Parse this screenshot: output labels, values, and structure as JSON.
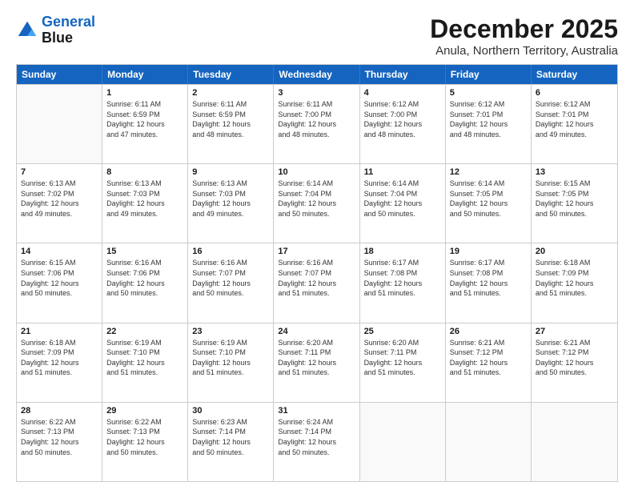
{
  "header": {
    "logo_line1": "General",
    "logo_line2": "Blue",
    "title": "December 2025",
    "subtitle": "Anula, Northern Territory, Australia"
  },
  "days_of_week": [
    "Sunday",
    "Monday",
    "Tuesday",
    "Wednesday",
    "Thursday",
    "Friday",
    "Saturday"
  ],
  "weeks": [
    [
      {
        "day": "",
        "lines": []
      },
      {
        "day": "1",
        "lines": [
          "Sunrise: 6:11 AM",
          "Sunset: 6:59 PM",
          "Daylight: 12 hours",
          "and 47 minutes."
        ]
      },
      {
        "day": "2",
        "lines": [
          "Sunrise: 6:11 AM",
          "Sunset: 6:59 PM",
          "Daylight: 12 hours",
          "and 48 minutes."
        ]
      },
      {
        "day": "3",
        "lines": [
          "Sunrise: 6:11 AM",
          "Sunset: 7:00 PM",
          "Daylight: 12 hours",
          "and 48 minutes."
        ]
      },
      {
        "day": "4",
        "lines": [
          "Sunrise: 6:12 AM",
          "Sunset: 7:00 PM",
          "Daylight: 12 hours",
          "and 48 minutes."
        ]
      },
      {
        "day": "5",
        "lines": [
          "Sunrise: 6:12 AM",
          "Sunset: 7:01 PM",
          "Daylight: 12 hours",
          "and 48 minutes."
        ]
      },
      {
        "day": "6",
        "lines": [
          "Sunrise: 6:12 AM",
          "Sunset: 7:01 PM",
          "Daylight: 12 hours",
          "and 49 minutes."
        ]
      }
    ],
    [
      {
        "day": "7",
        "lines": [
          "Sunrise: 6:13 AM",
          "Sunset: 7:02 PM",
          "Daylight: 12 hours",
          "and 49 minutes."
        ]
      },
      {
        "day": "8",
        "lines": [
          "Sunrise: 6:13 AM",
          "Sunset: 7:03 PM",
          "Daylight: 12 hours",
          "and 49 minutes."
        ]
      },
      {
        "day": "9",
        "lines": [
          "Sunrise: 6:13 AM",
          "Sunset: 7:03 PM",
          "Daylight: 12 hours",
          "and 49 minutes."
        ]
      },
      {
        "day": "10",
        "lines": [
          "Sunrise: 6:14 AM",
          "Sunset: 7:04 PM",
          "Daylight: 12 hours",
          "and 50 minutes."
        ]
      },
      {
        "day": "11",
        "lines": [
          "Sunrise: 6:14 AM",
          "Sunset: 7:04 PM",
          "Daylight: 12 hours",
          "and 50 minutes."
        ]
      },
      {
        "day": "12",
        "lines": [
          "Sunrise: 6:14 AM",
          "Sunset: 7:05 PM",
          "Daylight: 12 hours",
          "and 50 minutes."
        ]
      },
      {
        "day": "13",
        "lines": [
          "Sunrise: 6:15 AM",
          "Sunset: 7:05 PM",
          "Daylight: 12 hours",
          "and 50 minutes."
        ]
      }
    ],
    [
      {
        "day": "14",
        "lines": [
          "Sunrise: 6:15 AM",
          "Sunset: 7:06 PM",
          "Daylight: 12 hours",
          "and 50 minutes."
        ]
      },
      {
        "day": "15",
        "lines": [
          "Sunrise: 6:16 AM",
          "Sunset: 7:06 PM",
          "Daylight: 12 hours",
          "and 50 minutes."
        ]
      },
      {
        "day": "16",
        "lines": [
          "Sunrise: 6:16 AM",
          "Sunset: 7:07 PM",
          "Daylight: 12 hours",
          "and 50 minutes."
        ]
      },
      {
        "day": "17",
        "lines": [
          "Sunrise: 6:16 AM",
          "Sunset: 7:07 PM",
          "Daylight: 12 hours",
          "and 51 minutes."
        ]
      },
      {
        "day": "18",
        "lines": [
          "Sunrise: 6:17 AM",
          "Sunset: 7:08 PM",
          "Daylight: 12 hours",
          "and 51 minutes."
        ]
      },
      {
        "day": "19",
        "lines": [
          "Sunrise: 6:17 AM",
          "Sunset: 7:08 PM",
          "Daylight: 12 hours",
          "and 51 minutes."
        ]
      },
      {
        "day": "20",
        "lines": [
          "Sunrise: 6:18 AM",
          "Sunset: 7:09 PM",
          "Daylight: 12 hours",
          "and 51 minutes."
        ]
      }
    ],
    [
      {
        "day": "21",
        "lines": [
          "Sunrise: 6:18 AM",
          "Sunset: 7:09 PM",
          "Daylight: 12 hours",
          "and 51 minutes."
        ]
      },
      {
        "day": "22",
        "lines": [
          "Sunrise: 6:19 AM",
          "Sunset: 7:10 PM",
          "Daylight: 12 hours",
          "and 51 minutes."
        ]
      },
      {
        "day": "23",
        "lines": [
          "Sunrise: 6:19 AM",
          "Sunset: 7:10 PM",
          "Daylight: 12 hours",
          "and 51 minutes."
        ]
      },
      {
        "day": "24",
        "lines": [
          "Sunrise: 6:20 AM",
          "Sunset: 7:11 PM",
          "Daylight: 12 hours",
          "and 51 minutes."
        ]
      },
      {
        "day": "25",
        "lines": [
          "Sunrise: 6:20 AM",
          "Sunset: 7:11 PM",
          "Daylight: 12 hours",
          "and 51 minutes."
        ]
      },
      {
        "day": "26",
        "lines": [
          "Sunrise: 6:21 AM",
          "Sunset: 7:12 PM",
          "Daylight: 12 hours",
          "and 51 minutes."
        ]
      },
      {
        "day": "27",
        "lines": [
          "Sunrise: 6:21 AM",
          "Sunset: 7:12 PM",
          "Daylight: 12 hours",
          "and 50 minutes."
        ]
      }
    ],
    [
      {
        "day": "28",
        "lines": [
          "Sunrise: 6:22 AM",
          "Sunset: 7:13 PM",
          "Daylight: 12 hours",
          "and 50 minutes."
        ]
      },
      {
        "day": "29",
        "lines": [
          "Sunrise: 6:22 AM",
          "Sunset: 7:13 PM",
          "Daylight: 12 hours",
          "and 50 minutes."
        ]
      },
      {
        "day": "30",
        "lines": [
          "Sunrise: 6:23 AM",
          "Sunset: 7:14 PM",
          "Daylight: 12 hours",
          "and 50 minutes."
        ]
      },
      {
        "day": "31",
        "lines": [
          "Sunrise: 6:24 AM",
          "Sunset: 7:14 PM",
          "Daylight: 12 hours",
          "and 50 minutes."
        ]
      },
      {
        "day": "",
        "lines": []
      },
      {
        "day": "",
        "lines": []
      },
      {
        "day": "",
        "lines": []
      }
    ]
  ]
}
